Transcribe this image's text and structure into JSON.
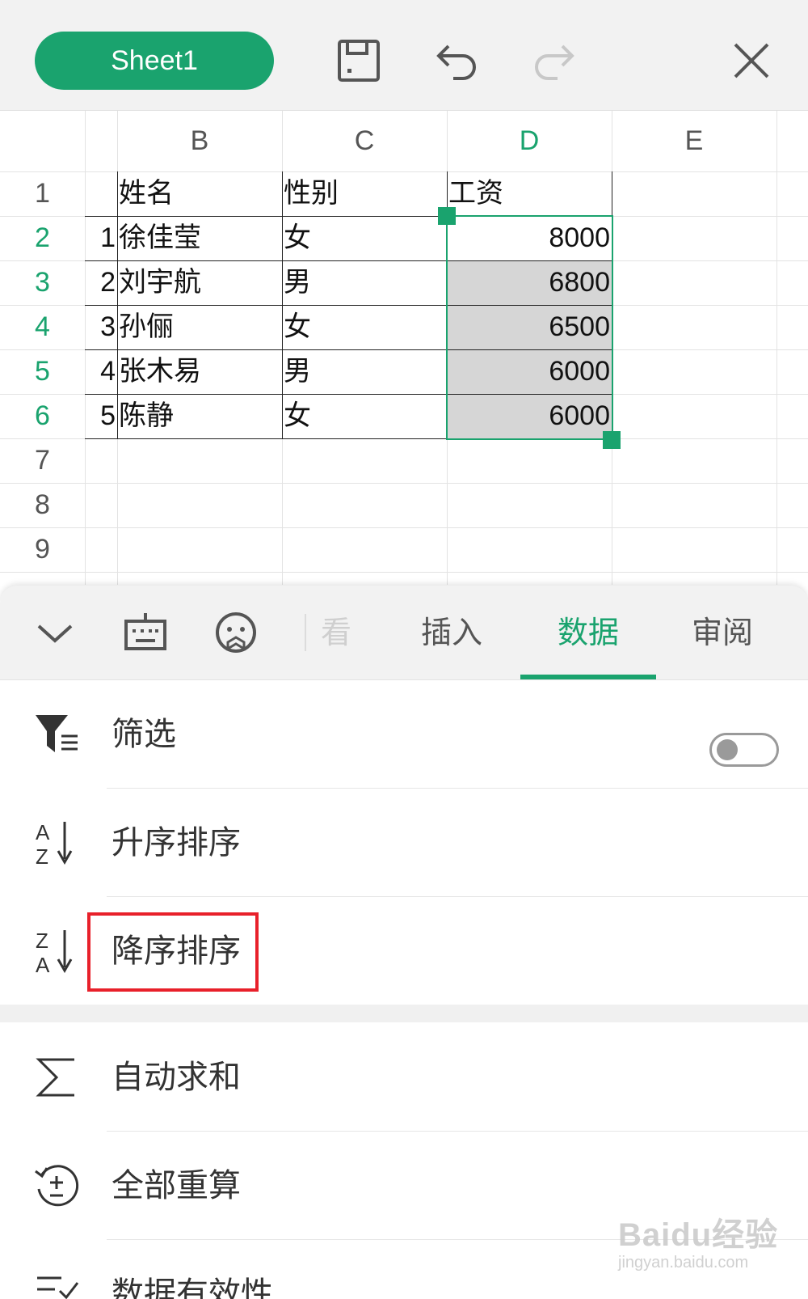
{
  "toolbar": {
    "sheet_name": "Sheet1",
    "icons": [
      "save-icon",
      "undo-icon",
      "redo-icon",
      "close-icon"
    ]
  },
  "sheet": {
    "column_headers": [
      "B",
      "C",
      "D",
      "E"
    ],
    "active_column": "D",
    "row_headers": [
      "1",
      "2",
      "3",
      "4",
      "5",
      "6",
      "7",
      "8",
      "9"
    ],
    "active_rows": [
      "2",
      "3",
      "4",
      "5",
      "6"
    ],
    "header_row": {
      "b": "姓名",
      "c": "性别",
      "d": "工资"
    },
    "rows": [
      {
        "a": "1",
        "b": "徐佳莹",
        "c": "女",
        "d": "8000"
      },
      {
        "a": "2",
        "b": "刘宇航",
        "c": "男",
        "d": "6800"
      },
      {
        "a": "3",
        "b": "孙俪",
        "c": "女",
        "d": "6500"
      },
      {
        "a": "4",
        "b": "张木易",
        "c": "男",
        "d": "6000"
      },
      {
        "a": "5",
        "b": "陈静",
        "c": "女",
        "d": "6000"
      }
    ],
    "selection": "D2:D6"
  },
  "panel": {
    "tabs": [
      {
        "label": "看",
        "state": "faded"
      },
      {
        "label": "插入",
        "state": "normal"
      },
      {
        "label": "数据",
        "state": "active"
      },
      {
        "label": "审阅",
        "state": "normal"
      }
    ],
    "menu": [
      {
        "label": "筛选",
        "icon": "filter-icon",
        "toggle": false
      },
      {
        "label": "升序排序",
        "icon": "sort-ascending-icon"
      },
      {
        "label": "降序排序",
        "icon": "sort-descending-icon",
        "highlighted": true
      },
      {
        "label": "自动求和",
        "icon": "sigma-icon"
      },
      {
        "label": "全部重算",
        "icon": "recalculate-icon"
      },
      {
        "label": "数据有效性",
        "icon": "data-validation-icon"
      }
    ]
  },
  "colors": {
    "accent": "#1aa36e",
    "highlight": "#e8202a",
    "selection_fill": "#d6d6d6"
  },
  "watermark": {
    "main": "Baidu经验",
    "sub": "jingyan.baidu.com"
  }
}
